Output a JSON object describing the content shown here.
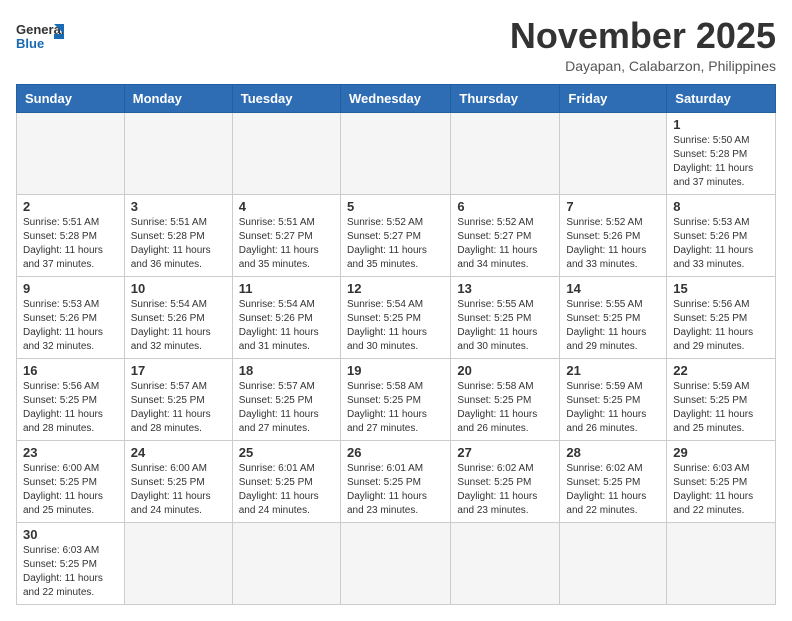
{
  "header": {
    "logo_general": "General",
    "logo_blue": "Blue",
    "month_title": "November 2025",
    "subtitle": "Dayapan, Calabarzon, Philippines"
  },
  "weekdays": [
    "Sunday",
    "Monday",
    "Tuesday",
    "Wednesday",
    "Thursday",
    "Friday",
    "Saturday"
  ],
  "weeks": [
    [
      {
        "day": "",
        "info": ""
      },
      {
        "day": "",
        "info": ""
      },
      {
        "day": "",
        "info": ""
      },
      {
        "day": "",
        "info": ""
      },
      {
        "day": "",
        "info": ""
      },
      {
        "day": "",
        "info": ""
      },
      {
        "day": "1",
        "info": "Sunrise: 5:50 AM\nSunset: 5:28 PM\nDaylight: 11 hours\nand 37 minutes."
      }
    ],
    [
      {
        "day": "2",
        "info": "Sunrise: 5:51 AM\nSunset: 5:28 PM\nDaylight: 11 hours\nand 37 minutes."
      },
      {
        "day": "3",
        "info": "Sunrise: 5:51 AM\nSunset: 5:28 PM\nDaylight: 11 hours\nand 36 minutes."
      },
      {
        "day": "4",
        "info": "Sunrise: 5:51 AM\nSunset: 5:27 PM\nDaylight: 11 hours\nand 35 minutes."
      },
      {
        "day": "5",
        "info": "Sunrise: 5:52 AM\nSunset: 5:27 PM\nDaylight: 11 hours\nand 35 minutes."
      },
      {
        "day": "6",
        "info": "Sunrise: 5:52 AM\nSunset: 5:27 PM\nDaylight: 11 hours\nand 34 minutes."
      },
      {
        "day": "7",
        "info": "Sunrise: 5:52 AM\nSunset: 5:26 PM\nDaylight: 11 hours\nand 33 minutes."
      },
      {
        "day": "8",
        "info": "Sunrise: 5:53 AM\nSunset: 5:26 PM\nDaylight: 11 hours\nand 33 minutes."
      }
    ],
    [
      {
        "day": "9",
        "info": "Sunrise: 5:53 AM\nSunset: 5:26 PM\nDaylight: 11 hours\nand 32 minutes."
      },
      {
        "day": "10",
        "info": "Sunrise: 5:54 AM\nSunset: 5:26 PM\nDaylight: 11 hours\nand 32 minutes."
      },
      {
        "day": "11",
        "info": "Sunrise: 5:54 AM\nSunset: 5:26 PM\nDaylight: 11 hours\nand 31 minutes."
      },
      {
        "day": "12",
        "info": "Sunrise: 5:54 AM\nSunset: 5:25 PM\nDaylight: 11 hours\nand 30 minutes."
      },
      {
        "day": "13",
        "info": "Sunrise: 5:55 AM\nSunset: 5:25 PM\nDaylight: 11 hours\nand 30 minutes."
      },
      {
        "day": "14",
        "info": "Sunrise: 5:55 AM\nSunset: 5:25 PM\nDaylight: 11 hours\nand 29 minutes."
      },
      {
        "day": "15",
        "info": "Sunrise: 5:56 AM\nSunset: 5:25 PM\nDaylight: 11 hours\nand 29 minutes."
      }
    ],
    [
      {
        "day": "16",
        "info": "Sunrise: 5:56 AM\nSunset: 5:25 PM\nDaylight: 11 hours\nand 28 minutes."
      },
      {
        "day": "17",
        "info": "Sunrise: 5:57 AM\nSunset: 5:25 PM\nDaylight: 11 hours\nand 28 minutes."
      },
      {
        "day": "18",
        "info": "Sunrise: 5:57 AM\nSunset: 5:25 PM\nDaylight: 11 hours\nand 27 minutes."
      },
      {
        "day": "19",
        "info": "Sunrise: 5:58 AM\nSunset: 5:25 PM\nDaylight: 11 hours\nand 27 minutes."
      },
      {
        "day": "20",
        "info": "Sunrise: 5:58 AM\nSunset: 5:25 PM\nDaylight: 11 hours\nand 26 minutes."
      },
      {
        "day": "21",
        "info": "Sunrise: 5:59 AM\nSunset: 5:25 PM\nDaylight: 11 hours\nand 26 minutes."
      },
      {
        "day": "22",
        "info": "Sunrise: 5:59 AM\nSunset: 5:25 PM\nDaylight: 11 hours\nand 25 minutes."
      }
    ],
    [
      {
        "day": "23",
        "info": "Sunrise: 6:00 AM\nSunset: 5:25 PM\nDaylight: 11 hours\nand 25 minutes."
      },
      {
        "day": "24",
        "info": "Sunrise: 6:00 AM\nSunset: 5:25 PM\nDaylight: 11 hours\nand 24 minutes."
      },
      {
        "day": "25",
        "info": "Sunrise: 6:01 AM\nSunset: 5:25 PM\nDaylight: 11 hours\nand 24 minutes."
      },
      {
        "day": "26",
        "info": "Sunrise: 6:01 AM\nSunset: 5:25 PM\nDaylight: 11 hours\nand 23 minutes."
      },
      {
        "day": "27",
        "info": "Sunrise: 6:02 AM\nSunset: 5:25 PM\nDaylight: 11 hours\nand 23 minutes."
      },
      {
        "day": "28",
        "info": "Sunrise: 6:02 AM\nSunset: 5:25 PM\nDaylight: 11 hours\nand 22 minutes."
      },
      {
        "day": "29",
        "info": "Sunrise: 6:03 AM\nSunset: 5:25 PM\nDaylight: 11 hours\nand 22 minutes."
      }
    ],
    [
      {
        "day": "30",
        "info": "Sunrise: 6:03 AM\nSunset: 5:25 PM\nDaylight: 11 hours\nand 22 minutes."
      },
      {
        "day": "",
        "info": ""
      },
      {
        "day": "",
        "info": ""
      },
      {
        "day": "",
        "info": ""
      },
      {
        "day": "",
        "info": ""
      },
      {
        "day": "",
        "info": ""
      },
      {
        "day": "",
        "info": ""
      }
    ]
  ]
}
